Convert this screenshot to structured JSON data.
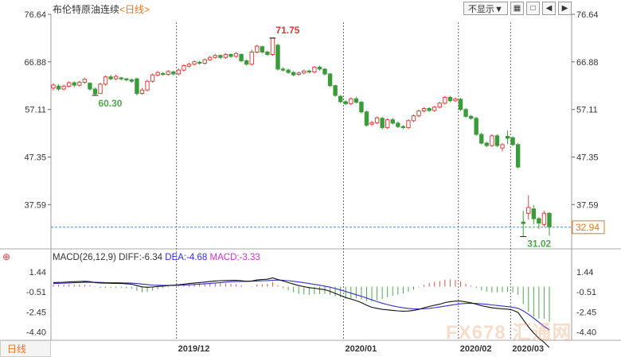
{
  "header": {
    "instrument": "布伦特原油连续",
    "period": "<日线>",
    "hide_label": "不显示▼"
  },
  "toolbar_icons": [
    "chart-type-icon",
    "fullscreen-icon",
    "prev-icon",
    "next-icon"
  ],
  "chart_data": [
    {
      "type": "candlestick",
      "y_ticks": [
        "76.64",
        "66.88",
        "57.11",
        "47.35",
        "37.59"
      ],
      "y_range": [
        28.5,
        76.64
      ],
      "x_ticks": [
        "2019/12",
        "2020/01",
        "2020/02",
        "2020/03"
      ],
      "annotations": {
        "low_label": "60.30",
        "high_label": "71.75",
        "recent_low_label": "31.02"
      },
      "last_price": "32.94",
      "candles": [
        [
          61.5,
          62.1,
          61.0,
          62.5
        ],
        [
          61.9,
          61.3,
          60.9,
          62.3
        ],
        [
          61.3,
          61.9,
          61.0,
          62.2
        ],
        [
          61.9,
          62.6,
          61.6,
          62.9
        ],
        [
          62.6,
          62.1,
          61.7,
          62.9
        ],
        [
          62.1,
          62.7,
          61.8,
          63.0
        ],
        [
          62.7,
          63.3,
          62.4,
          63.6
        ],
        [
          62.5,
          61.3,
          61.0,
          62.7
        ],
        [
          61.3,
          60.3,
          59.9,
          61.6
        ],
        [
          60.4,
          62.3,
          60.3,
          62.6
        ],
        [
          62.3,
          63.8,
          62.0,
          64.1
        ],
        [
          63.8,
          63.4,
          63.1,
          64.2
        ],
        [
          63.4,
          63.9,
          63.1,
          64.3
        ],
        [
          63.6,
          63.4,
          63.1,
          63.8
        ],
        [
          63.4,
          63.2,
          62.9,
          63.6
        ],
        [
          63.2,
          62.9,
          62.6,
          63.5
        ],
        [
          63.4,
          60.4,
          60.0,
          63.6
        ],
        [
          60.4,
          61.1,
          60.1,
          61.5
        ],
        [
          61.1,
          62.9,
          60.8,
          63.2
        ],
        [
          62.9,
          64.2,
          62.6,
          64.5
        ],
        [
          64.2,
          64.7,
          63.9,
          65.0
        ],
        [
          64.5,
          64.3,
          64.0,
          64.8
        ],
        [
          64.3,
          64.9,
          64.0,
          65.2
        ],
        [
          64.8,
          64.4,
          64.1,
          65.1
        ],
        [
          64.4,
          65.2,
          64.1,
          65.5
        ],
        [
          65.2,
          66.1,
          64.9,
          66.4
        ],
        [
          66.0,
          66.4,
          65.7,
          66.7
        ],
        [
          66.4,
          66.9,
          66.1,
          67.2
        ],
        [
          66.8,
          66.6,
          66.3,
          67.1
        ],
        [
          66.6,
          67.3,
          66.3,
          67.6
        ],
        [
          67.3,
          67.8,
          67.0,
          68.1
        ],
        [
          67.8,
          68.2,
          67.5,
          68.5
        ],
        [
          68.2,
          67.8,
          67.5,
          68.4
        ],
        [
          67.8,
          68.4,
          67.5,
          68.7
        ],
        [
          68.4,
          68.0,
          67.7,
          68.6
        ],
        [
          68.0,
          68.6,
          67.7,
          68.9
        ],
        [
          68.4,
          67.1,
          66.8,
          68.6
        ],
        [
          67.1,
          66.4,
          66.1,
          67.4
        ],
        [
          66.4,
          68.9,
          66.1,
          69.4
        ],
        [
          68.9,
          70.1,
          68.6,
          70.4
        ],
        [
          70.0,
          68.9,
          68.6,
          70.2
        ],
        [
          68.9,
          68.4,
          68.1,
          69.2
        ],
        [
          68.4,
          71.8,
          68.1,
          71.75
        ],
        [
          70.3,
          65.4,
          65.1,
          70.6
        ],
        [
          65.4,
          65.2,
          64.9,
          65.8
        ],
        [
          65.2,
          64.7,
          64.4,
          65.5
        ],
        [
          64.7,
          64.2,
          63.9,
          65.0
        ],
        [
          64.3,
          64.6,
          64.0,
          64.9
        ],
        [
          64.6,
          65.0,
          64.3,
          65.3
        ],
        [
          65.0,
          64.8,
          64.5,
          65.3
        ],
        [
          64.8,
          65.8,
          64.5,
          66.0
        ],
        [
          65.8,
          65.4,
          65.1,
          66.1
        ],
        [
          65.4,
          64.4,
          64.1,
          65.6
        ],
        [
          64.4,
          62.0,
          61.7,
          64.6
        ],
        [
          62.0,
          60.0,
          59.7,
          62.2
        ],
        [
          59.8,
          58.7,
          58.4,
          60.1
        ],
        [
          58.7,
          58.3,
          58.0,
          59.0
        ],
        [
          58.3,
          59.3,
          58.0,
          59.6
        ],
        [
          59.3,
          58.6,
          58.3,
          59.7
        ],
        [
          58.6,
          56.6,
          56.3,
          58.9
        ],
        [
          56.6,
          53.9,
          53.6,
          56.9
        ],
        [
          54.1,
          54.4,
          53.7,
          54.8
        ],
        [
          54.4,
          55.4,
          54.1,
          55.7
        ],
        [
          55.3,
          53.4,
          53.0,
          55.6
        ],
        [
          53.4,
          55.0,
          53.1,
          55.3
        ],
        [
          55.0,
          54.3,
          54.0,
          55.4
        ],
        [
          54.3,
          53.6,
          53.3,
          54.6
        ],
        [
          53.6,
          53.4,
          53.1,
          53.9
        ],
        [
          53.4,
          54.8,
          53.1,
          55.1
        ],
        [
          54.8,
          55.8,
          54.5,
          56.1
        ],
        [
          55.8,
          56.8,
          55.5,
          57.1
        ],
        [
          56.8,
          57.3,
          56.5,
          57.6
        ],
        [
          57.3,
          56.9,
          56.6,
          57.6
        ],
        [
          56.9,
          57.6,
          56.6,
          57.9
        ],
        [
          57.6,
          58.4,
          57.3,
          58.7
        ],
        [
          58.4,
          59.6,
          58.1,
          59.9
        ],
        [
          59.6,
          58.9,
          58.6,
          59.9
        ],
        [
          58.9,
          59.3,
          58.6,
          59.6
        ],
        [
          59.2,
          57.1,
          56.8,
          59.5
        ],
        [
          57.1,
          55.7,
          55.4,
          57.4
        ],
        [
          55.7,
          55.3,
          55.0,
          56.0
        ],
        [
          55.3,
          52.0,
          51.7,
          55.6
        ],
        [
          52.0,
          50.2,
          49.9,
          52.3
        ],
        [
          50.2,
          49.7,
          49.4,
          50.5
        ],
        [
          49.7,
          51.7,
          49.4,
          52.0
        ],
        [
          51.7,
          49.7,
          49.4,
          52.0
        ],
        [
          49.2,
          49.9,
          48.5,
          50.2
        ],
        [
          51.6,
          51.2,
          50.0,
          52.8
        ],
        [
          51.3,
          49.9,
          49.6,
          51.6
        ],
        [
          49.9,
          45.3,
          45.0,
          50.2
        ],
        [
          34.0,
          33.7,
          31.0,
          36.3
        ],
        [
          35.8,
          37.0,
          34.5,
          39.5
        ],
        [
          36.7,
          34.7,
          33.5,
          37.5
        ],
        [
          34.7,
          33.8,
          32.6,
          35.0
        ],
        [
          33.5,
          35.8,
          33.1,
          36.3
        ],
        [
          35.8,
          33.0,
          31.2,
          36.0
        ]
      ]
    },
    {
      "type": "macd",
      "params": "MACD(26,12,9)",
      "diff_label": "DIFF:-6.34",
      "dea_label": "DEA:-4.68",
      "macd_label": "MACD:-3.33",
      "y_ticks": [
        "1.44",
        "-0.51",
        "-2.45",
        "-4.40"
      ],
      "y_range": [
        -5.2,
        2.2
      ],
      "diff": [
        0.4,
        0.41,
        0.43,
        0.46,
        0.48,
        0.5,
        0.52,
        0.49,
        0.4,
        0.35,
        0.34,
        0.33,
        0.32,
        0.3,
        0.28,
        0.24,
        0.1,
        -0.02,
        -0.06,
        -0.03,
        0.02,
        0.06,
        0.1,
        0.14,
        0.18,
        0.24,
        0.3,
        0.36,
        0.4,
        0.44,
        0.5,
        0.55,
        0.58,
        0.6,
        0.61,
        0.62,
        0.58,
        0.52,
        0.55,
        0.65,
        0.7,
        0.72,
        0.85,
        0.7,
        0.55,
        0.4,
        0.25,
        0.1,
        0.0,
        -0.1,
        -0.15,
        -0.22,
        -0.3,
        -0.45,
        -0.65,
        -0.85,
        -1.05,
        -1.2,
        -1.35,
        -1.55,
        -1.8,
        -2.0,
        -2.1,
        -2.2,
        -2.25,
        -2.3,
        -2.35,
        -2.38,
        -2.36,
        -2.3,
        -2.2,
        -2.05,
        -1.92,
        -1.8,
        -1.7,
        -1.55,
        -1.45,
        -1.4,
        -1.4,
        -1.48,
        -1.56,
        -1.7,
        -1.85,
        -1.95,
        -2.05,
        -2.1,
        -2.15,
        -2.18,
        -2.28,
        -2.5,
        -3.2,
        -3.9,
        -4.5,
        -5.0,
        -5.4,
        -5.9
      ],
      "dea": [
        0.3,
        0.32,
        0.34,
        0.36,
        0.38,
        0.4,
        0.42,
        0.43,
        0.42,
        0.41,
        0.4,
        0.39,
        0.38,
        0.37,
        0.36,
        0.34,
        0.3,
        0.25,
        0.2,
        0.16,
        0.14,
        0.13,
        0.13,
        0.13,
        0.14,
        0.16,
        0.18,
        0.21,
        0.24,
        0.28,
        0.32,
        0.36,
        0.4,
        0.44,
        0.47,
        0.5,
        0.51,
        0.52,
        0.53,
        0.55,
        0.57,
        0.59,
        0.62,
        0.64,
        0.62,
        0.58,
        0.52,
        0.45,
        0.38,
        0.3,
        0.22,
        0.14,
        0.05,
        -0.05,
        -0.18,
        -0.32,
        -0.47,
        -0.63,
        -0.78,
        -0.93,
        -1.1,
        -1.28,
        -1.45,
        -1.6,
        -1.74,
        -1.86,
        -1.96,
        -2.05,
        -2.11,
        -2.15,
        -2.16,
        -2.14,
        -2.1,
        -2.04,
        -1.97,
        -1.89,
        -1.8,
        -1.72,
        -1.66,
        -1.62,
        -1.61,
        -1.63,
        -1.67,
        -1.71,
        -1.77,
        -1.82,
        -1.88,
        -1.93,
        -2.0,
        -2.1,
        -2.35,
        -2.68,
        -3.05,
        -3.45,
        -3.85,
        -4.2
      ]
    }
  ]
}
